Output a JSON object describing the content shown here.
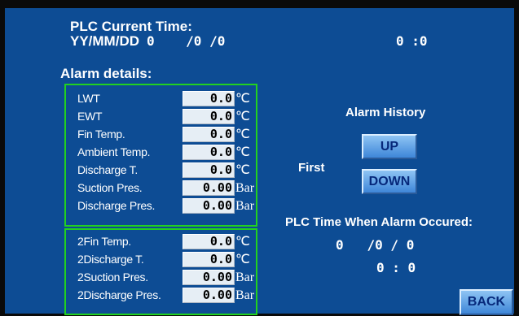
{
  "header": {
    "title": "PLC Current Time:",
    "date_label": "YY/MM/DD",
    "date_value": "0    /0 /0",
    "time_value": "0 :0"
  },
  "alarm_details_title": "Alarm details:",
  "alarm_group_1": [
    {
      "label": "LWT",
      "value": "0.0",
      "unit": "℃"
    },
    {
      "label": "EWT",
      "value": "0.0",
      "unit": "℃"
    },
    {
      "label": "Fin Temp.",
      "value": "0.0",
      "unit": "℃"
    },
    {
      "label": "Ambient Temp.",
      "value": "0.0",
      "unit": "℃"
    },
    {
      "label": "Discharge T.",
      "value": "0.0",
      "unit": "℃"
    },
    {
      "label": "Suction Pres.",
      "value": "0.00",
      "unit": "Bar"
    },
    {
      "label": "Discharge Pres.",
      "value": "0.00",
      "unit": "Bar"
    }
  ],
  "alarm_group_2": [
    {
      "label": "2Fin Temp.",
      "value": "0.0",
      "unit": "℃"
    },
    {
      "label": "2Discharge T.",
      "value": "0.0",
      "unit": "℃"
    },
    {
      "label": "2Suction Pres.",
      "value": "0.00",
      "unit": "Bar"
    },
    {
      "label": "2Discharge Pres.",
      "value": "0.00",
      "unit": "Bar"
    }
  ],
  "history": {
    "title": "Alarm History",
    "position": "First",
    "up_label": "UP",
    "down_label": "DOWN"
  },
  "alarm_time": {
    "title": "PLC Time When Alarm Occured:",
    "date_value": "0   /0 / 0",
    "time_value": "0 : 0"
  },
  "back_label": "BACK",
  "colors": {
    "background": "#0d4c94",
    "group_border": "#22d11f",
    "button": "#5a9fe4"
  }
}
